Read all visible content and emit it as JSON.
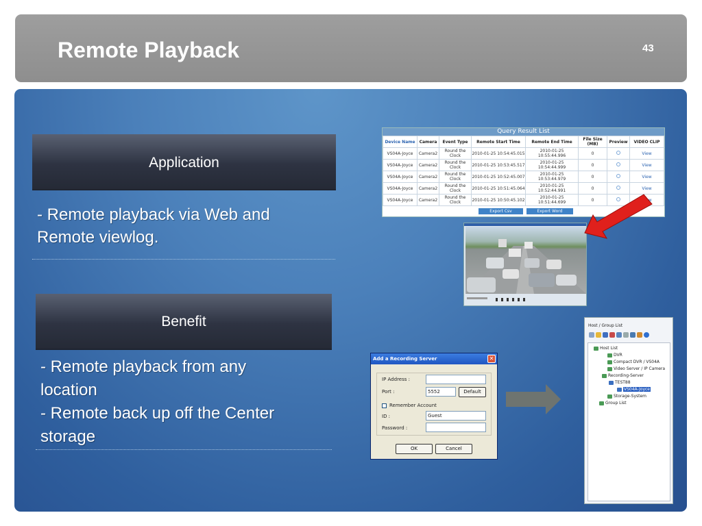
{
  "slide": {
    "title": "Remote Playback",
    "page_number": "43"
  },
  "application": {
    "heading": "Application",
    "line1": "-  Remote playback via Web and",
    "line2": "Remote viewlog."
  },
  "benefit": {
    "heading": "Benefit",
    "line1": "- Remote playback from any",
    "line2": "location",
    "line3": "- Remote back up off the Center",
    "line4": "storage"
  },
  "query_result": {
    "title": "Query Result List",
    "columns": [
      "Device Name",
      "Camera",
      "Event Type",
      "Remote Start Time",
      "Remote End Time",
      "File Size (MB)",
      "Preview",
      "VIDEO CLIP"
    ],
    "rows": [
      {
        "device": "VS04A-Joyce",
        "camera": "Camera2",
        "event": "Round the Clock",
        "start": "2010-01-25 10:54:45.015",
        "end": "2010-01-25 10:55:44.996",
        "size": "0",
        "clip": "View"
      },
      {
        "device": "VS04A-Joyce",
        "camera": "Camera2",
        "event": "Round the Clock",
        "start": "2010-01-25 10:53:45.517",
        "end": "2010-01-25 10:54:44.999",
        "size": "0",
        "clip": "View"
      },
      {
        "device": "VS04A-Joyce",
        "camera": "Camera2",
        "event": "Round the Clock",
        "start": "2010-01-25 10:52:45.007",
        "end": "2010-01-25 10:53:44.979",
        "size": "0",
        "clip": "View"
      },
      {
        "device": "VS04A-Joyce",
        "camera": "Camera2",
        "event": "Round the Clock",
        "start": "2010-01-25 10:51:45.064",
        "end": "2010-01-25 10:52:44.991",
        "size": "0",
        "clip": "View"
      },
      {
        "device": "VS04A-Joyce",
        "camera": "Camera2",
        "event": "Round the Clock",
        "start": "2010-01-25 10:50:45.102",
        "end": "2010-01-25 10:51:44.699",
        "size": "0",
        "clip": "View"
      }
    ],
    "export_csv": "Export Csv",
    "export_word": "Export Word"
  },
  "dialog": {
    "title": "Add a Recording Server",
    "ip_label": "IP Address :",
    "ip_value": "",
    "port_label": "Port :",
    "port_value": "5552",
    "default_button": "Default",
    "remember_label": "Remember Account",
    "id_label": "ID :",
    "id_value": "Guest",
    "password_label": "Password :",
    "password_value": "",
    "ok_button": "OK",
    "cancel_button": "Cancel"
  },
  "host_tree": {
    "title": "Host / Group List",
    "nodes": [
      "Host List",
      "DVR",
      "Compact DVR / VS04A",
      "Video Server / IP Camera",
      "Recording-Server",
      "TEST88",
      "VS04A-Joyce",
      "Storage-System",
      "Group List"
    ]
  },
  "colors": {
    "header_gray": "#9e9e9e",
    "panel_blue": "#4b80ba",
    "section_dark": "#2e3342",
    "red_arrow": "#e0201c",
    "gray_arrow": "#6e7470"
  }
}
